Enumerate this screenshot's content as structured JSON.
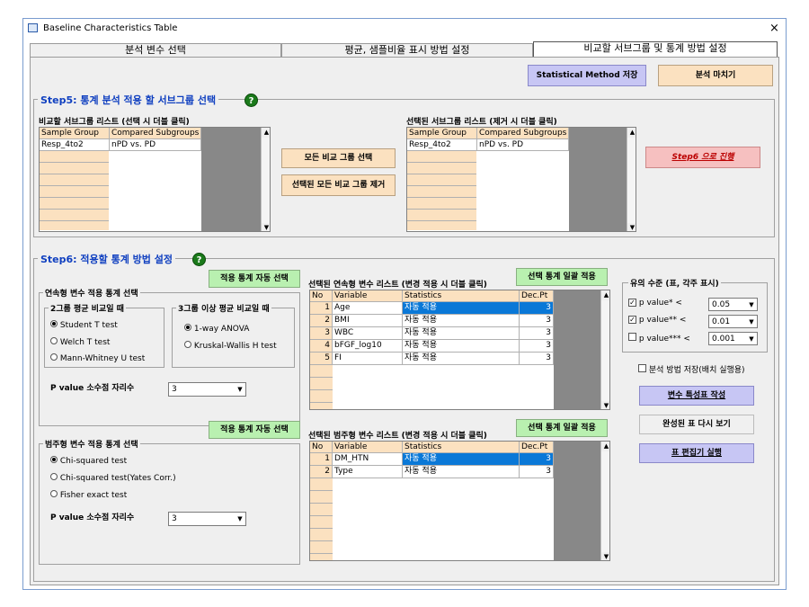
{
  "window": {
    "title": "Baseline Characteristics Table",
    "close": "×"
  },
  "tabs": [
    "분석 변수 선택",
    "평균, 샘플비율 표시 방법 설정",
    "비교할 서브그룹 및 통계 방법 설정"
  ],
  "top_buttons": {
    "save_method": "Statistical Method 저장",
    "finish": "분석 마치기"
  },
  "step5": {
    "title": "Step5: 통계 분석 적용 할 서브그룹 선택",
    "help": "?",
    "left_list_label": "비교할 서브그룹 리스트 (선택 시 더블 클릭)",
    "right_list_label": "선택된 서브그룹 리스트 (제거 시 더블 클릭)",
    "columns": [
      "Sample Group",
      "Compared Subgroups"
    ],
    "left_rows": [
      [
        "Resp_4to2",
        "nPD vs. PD"
      ]
    ],
    "right_rows": [
      [
        "Resp_4to2",
        "nPD vs. PD"
      ]
    ],
    "select_all": "모든 비교 그룹 선택",
    "remove_all": "선택된 모든 비교 그룹 제거",
    "proceed": "Step6 으로 진행"
  },
  "step6": {
    "title": "Step6: 적용할 통계 방법 설정",
    "help": "?",
    "auto_select_cont": "적용 통계 자동 선택",
    "auto_select_cat": "적용 통계 자동 선택",
    "continuous": {
      "group_title": "연속형 변수 적용 통계 선택",
      "two_group_title": "2그룹 평균 비교일 때",
      "two_group_options": [
        "Student T test",
        "Welch T test",
        "Mann-Whitney U test"
      ],
      "two_group_selected": 0,
      "multi_group_title": "3그룹 이상 평균 비교일 때",
      "multi_group_options": [
        "1-way ANOVA",
        "Kruskal-Wallis H test"
      ],
      "multi_group_selected": 0,
      "pvalue_label": "P value 소수점 자리수",
      "pvalue_digits": "3"
    },
    "categorical": {
      "group_title": "범주형 변수 적용 통계 선택",
      "options": [
        "Chi-squared test",
        "Chi-squared test(Yates Corr.)",
        "Fisher exact test"
      ],
      "selected": 0,
      "pvalue_label": "P value 소수점 자리수",
      "pvalue_digits": "3"
    },
    "cont_list_label": "선택된 연속형 변수 리스트 (변경 적용 시 더블 클릭)",
    "cat_list_label": "선택된 범주형 변수 리스트 (변경 적용 시 더블 클릭)",
    "apply_all_cont": "선택 통계 일괄 적용",
    "apply_all_cat": "선택 통계 일괄 적용",
    "table_columns": [
      "No",
      "Variable",
      "Statistics",
      "Dec.Pt"
    ],
    "cont_rows": [
      [
        "1",
        "Age",
        "자동 적용",
        "3"
      ],
      [
        "2",
        "BMI",
        "자동 적용",
        "3"
      ],
      [
        "3",
        "WBC",
        "자동 적용",
        "3"
      ],
      [
        "4",
        "bFGF_log10",
        "자동 적용",
        "3"
      ],
      [
        "5",
        "FI",
        "자동 적용",
        "3"
      ]
    ],
    "cat_rows": [
      [
        "1",
        "DM_HTN",
        "자동 적용",
        "3"
      ],
      [
        "2",
        "Type",
        "자동 적용",
        "3"
      ]
    ],
    "significance": {
      "title": "유의 수준 (표, 각주 표시)",
      "rows": [
        {
          "label": "p value* <",
          "checked": true,
          "value": "0.05"
        },
        {
          "label": "p value** <",
          "checked": true,
          "value": "0.01"
        },
        {
          "label": "p value*** <",
          "checked": false,
          "value": "0.001"
        }
      ]
    },
    "save_batch_label": "분석 방법 저장(배치 실행용)",
    "make_table": "변수 특성표 작성",
    "view_again": "완성된 표 다시 보기",
    "run_editor": "표 편집기 실행"
  }
}
